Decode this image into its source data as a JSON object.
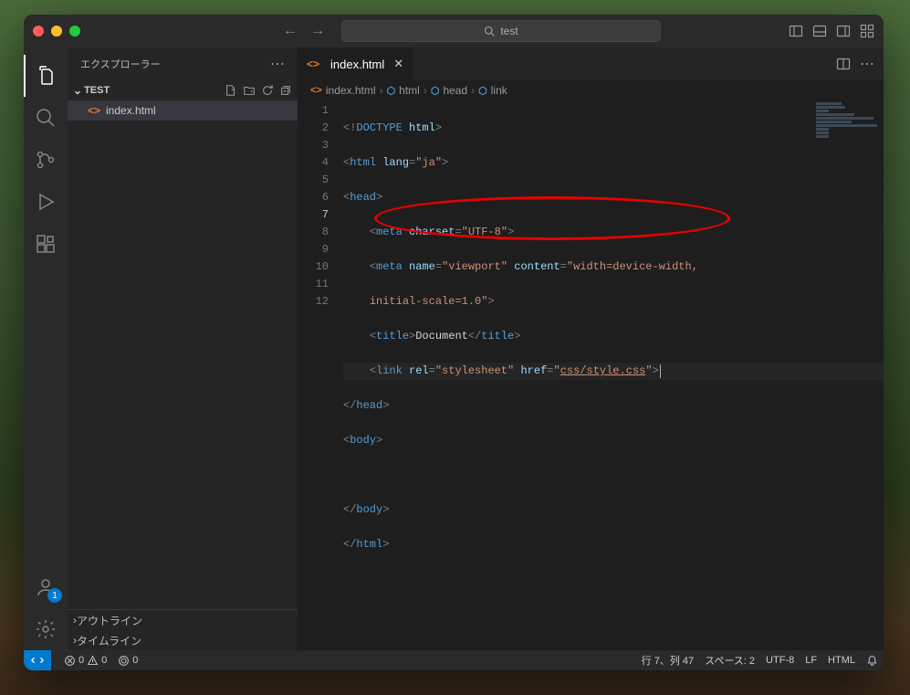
{
  "search": {
    "placeholder": "test"
  },
  "sidebar": {
    "title": "エクスプローラー",
    "workspace": "TEST",
    "file": "index.html",
    "outline": "アウトライン",
    "timeline": "タイムライン"
  },
  "tab": {
    "filename": "index.html"
  },
  "breadcrumbs": {
    "file": "index.html",
    "html": "html",
    "head": "head",
    "link": "link"
  },
  "editor": {
    "gutter": [
      "1",
      "2",
      "3",
      "4",
      "5",
      "6",
      "7",
      "8",
      "9",
      "10",
      "11",
      "12"
    ],
    "active_line_index": 6,
    "line1": {
      "a": "<!",
      "b": "DOCTYPE",
      "c": " html",
      "d": ">"
    },
    "line2": {
      "a": "<",
      "b": "html",
      "c": " lang",
      "d": "=",
      "e": "\"ja\"",
      "f": ">"
    },
    "line3": {
      "a": "<",
      "b": "head",
      "c": ">"
    },
    "line4": {
      "indent": "    ",
      "a": "<",
      "b": "meta",
      "c": " charset",
      "d": "=",
      "e": "\"UTF-8\"",
      "f": ">"
    },
    "line5": {
      "indent": "    ",
      "a": "<",
      "b": "meta",
      "c": " name",
      "d": "=",
      "e": "\"viewport\"",
      "f": " content",
      "g": "=",
      "h": "\"width=device-width, "
    },
    "line5b": {
      "indent": "    ",
      "a": "initial-scale=1.0\"",
      "b": ">"
    },
    "line6": {
      "indent": "    ",
      "a": "<",
      "b": "title",
      "c": ">",
      "d": "Document",
      "e": "</",
      "f": "title",
      "g": ">"
    },
    "line7": {
      "indent": "    ",
      "a": "<",
      "b": "link",
      "c": " rel",
      "d": "=",
      "e": "\"stylesheet\"",
      "f": " href",
      "g": "=",
      "h": "\"",
      "i": "css/style.css",
      "j": "\"",
      "k": ">"
    },
    "line8": {
      "a": "</",
      "b": "head",
      "c": ">"
    },
    "line9": {
      "a": "<",
      "b": "body",
      "c": ">"
    },
    "line11": {
      "a": "</",
      "b": "body",
      "c": ">"
    },
    "line12": {
      "a": "</",
      "b": "html",
      "c": ">"
    }
  },
  "statusbar": {
    "errors": "0",
    "warnings": "0",
    "ports": "0",
    "cursor": "行 7、列 47",
    "spaces": "スペース: 2",
    "encoding": "UTF-8",
    "eol": "LF",
    "language": "HTML"
  },
  "activity": {
    "accounts_badge": "1"
  }
}
